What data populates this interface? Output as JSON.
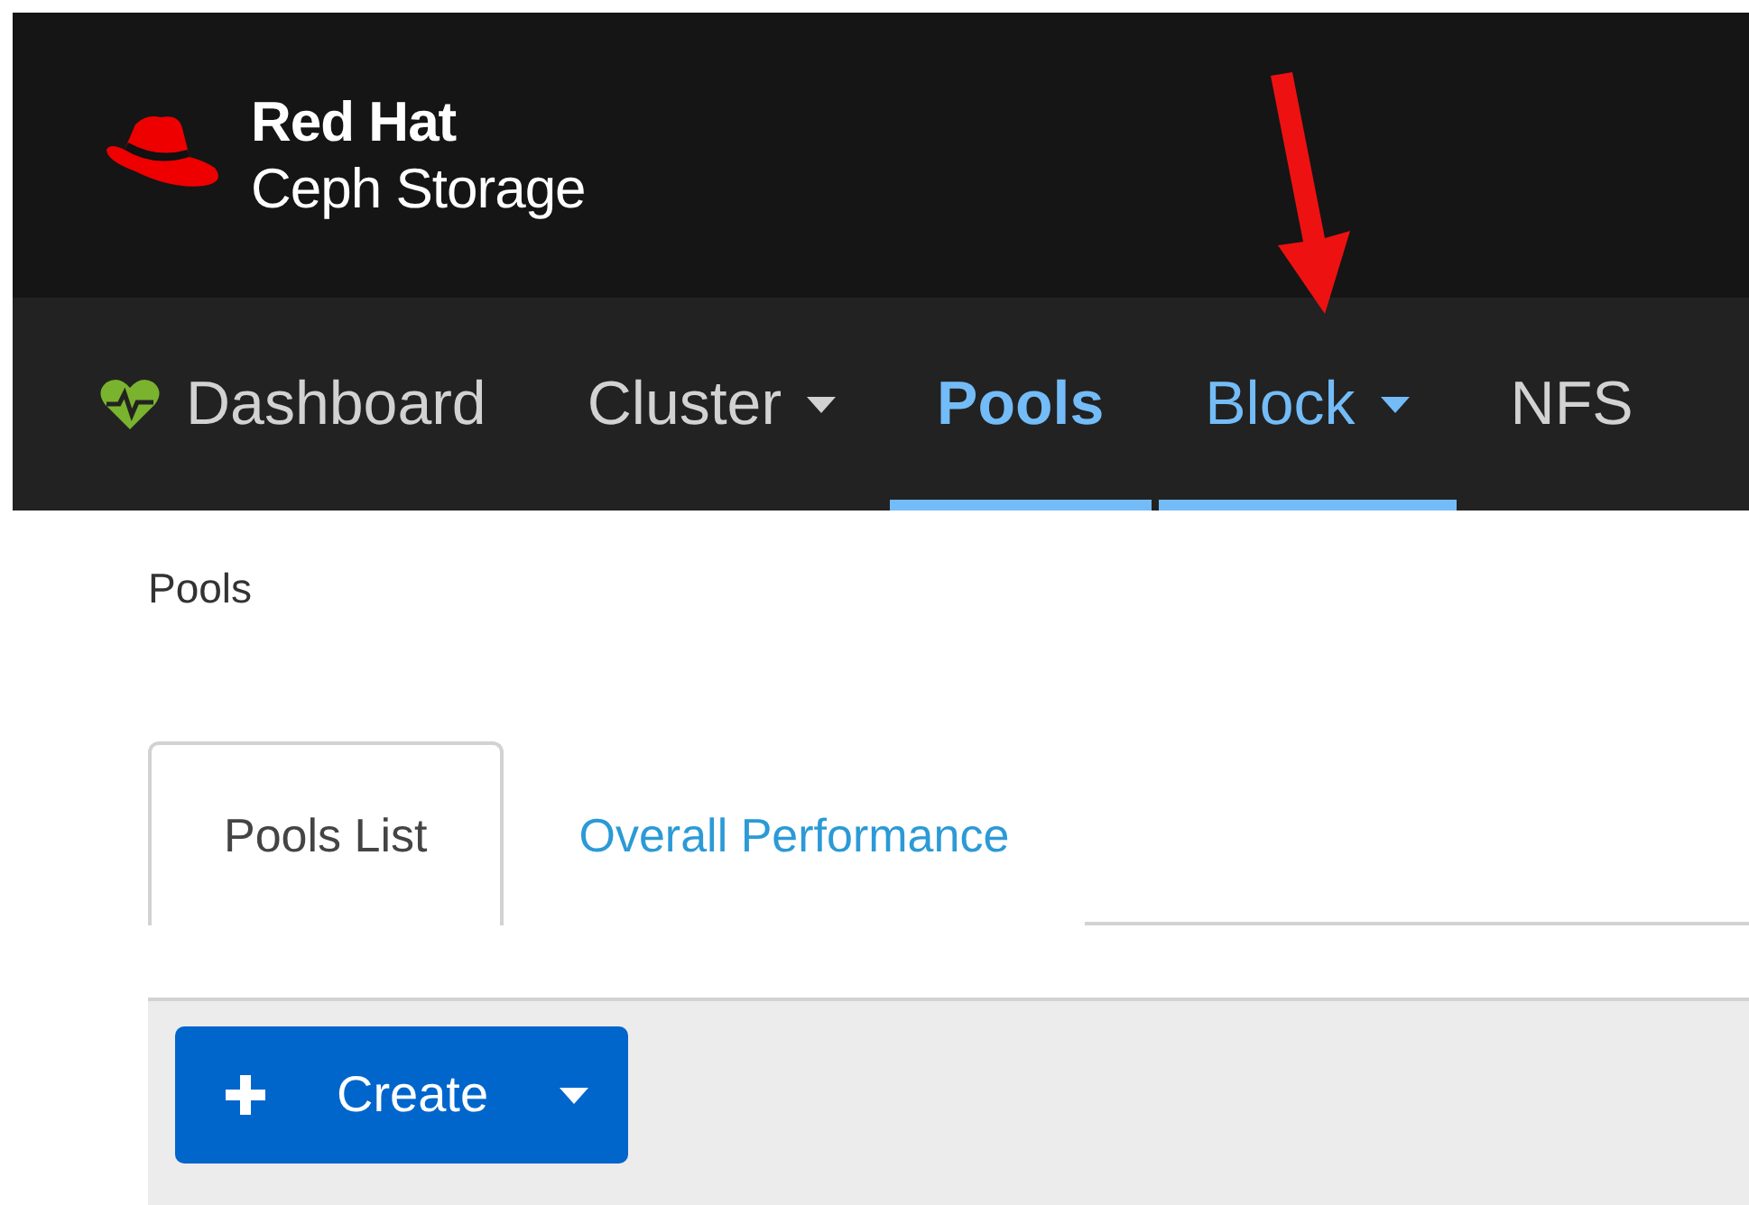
{
  "brand": {
    "line_1": "Red Hat",
    "line_2": "Ceph Storage"
  },
  "nav": [
    {
      "label": "Dashboard",
      "kind": "icon-link",
      "selected": false
    },
    {
      "label": "Cluster",
      "kind": "dropdown",
      "selected": false
    },
    {
      "label": "Pools",
      "kind": "link",
      "selected": true
    },
    {
      "label": "Block",
      "kind": "dropdown",
      "selected": true
    },
    {
      "label": "NFS",
      "kind": "link",
      "selected": false
    }
  ],
  "breadcrumb": "Pools",
  "tabs": [
    {
      "label": "Pools List",
      "selected": true
    },
    {
      "label": "Overall Performance",
      "selected": false
    }
  ],
  "toolbar": {
    "create_button": "Create"
  }
}
